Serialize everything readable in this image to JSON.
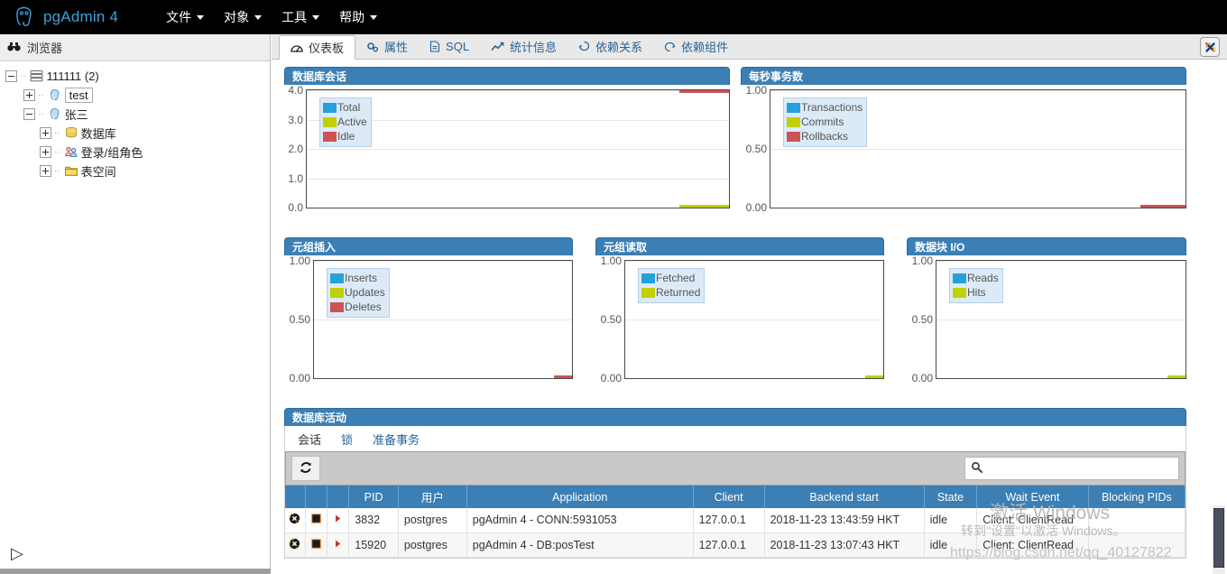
{
  "app": {
    "brand": "pgAdmin 4",
    "logo_icon": "pgadmin-elephant-logo"
  },
  "menubar": {
    "items": [
      {
        "label": "文件",
        "icon": "chevron-down-icon"
      },
      {
        "label": "对象",
        "icon": "chevron-down-icon"
      },
      {
        "label": "工具",
        "icon": "chevron-down-icon"
      },
      {
        "label": "帮助",
        "icon": "chevron-down-icon"
      }
    ]
  },
  "sidebar": {
    "header": "浏览器",
    "header_icon": "binoculars-icon",
    "expand_toggle": "▷",
    "tree": [
      {
        "label": "111111 (2)",
        "icon": "server-group-icon",
        "toggle": "minus",
        "depth": 0,
        "selected": false
      },
      {
        "label": "test",
        "icon": "server-icon",
        "toggle": "plus",
        "depth": 1,
        "selected": true
      },
      {
        "label": "张三",
        "icon": "server-icon",
        "toggle": "minus",
        "depth": 1,
        "selected": false
      },
      {
        "label": "数据库",
        "icon": "database-icon",
        "toggle": "plus",
        "depth": 2,
        "selected": false
      },
      {
        "label": "登录/组角色",
        "icon": "roles-icon",
        "toggle": "plus",
        "depth": 2,
        "selected": false
      },
      {
        "label": "表空间",
        "icon": "tablespace-icon",
        "toggle": "plus",
        "depth": 2,
        "selected": false
      }
    ]
  },
  "tabs": {
    "items": [
      {
        "label": "仪表板",
        "icon": "dashboard-icon",
        "active": true
      },
      {
        "label": "属性",
        "icon": "properties-gears-icon",
        "active": false
      },
      {
        "label": "SQL",
        "icon": "sql-file-icon",
        "active": false
      },
      {
        "label": "统计信息",
        "icon": "statistics-chart-icon",
        "active": false
      },
      {
        "label": "依赖关系",
        "icon": "dependencies-icon",
        "active": false
      },
      {
        "label": "依赖组件",
        "icon": "dependents-icon",
        "active": false
      }
    ],
    "close_label": "✖"
  },
  "colors": {
    "panel_header": "#3b7fb5",
    "series_blue": "#26a0da",
    "series_green": "#c0d000",
    "series_red": "#cc5254",
    "brand_blue": "#3ea0dc",
    "header_bg": "#000000"
  },
  "chart_data": [
    {
      "type": "line",
      "title": "数据库会话",
      "xlabel": "",
      "ylabel": "",
      "ylim": [
        0,
        4
      ],
      "yticks": [
        "0.0",
        "1.0",
        "2.0",
        "3.0",
        "4.0"
      ],
      "grid": true,
      "legend_position": "top-left",
      "series": [
        {
          "name": "Total",
          "color": "#26a0da",
          "values": [
            4
          ]
        },
        {
          "name": "Active",
          "color": "#c0d000",
          "values": [
            0
          ]
        },
        {
          "name": "Idle",
          "color": "#cc5254",
          "values": [
            4
          ]
        }
      ]
    },
    {
      "type": "line",
      "title": "每秒事务数",
      "xlabel": "",
      "ylabel": "",
      "ylim": [
        0,
        1
      ],
      "yticks": [
        "0.00",
        "0.50",
        "1.00"
      ],
      "grid": true,
      "legend_position": "top-left",
      "series": [
        {
          "name": "Transactions",
          "color": "#26a0da",
          "values": [
            0
          ]
        },
        {
          "name": "Commits",
          "color": "#c0d000",
          "values": [
            0
          ]
        },
        {
          "name": "Rollbacks",
          "color": "#cc5254",
          "values": [
            0
          ]
        }
      ]
    },
    {
      "type": "line",
      "title": "元组插入",
      "xlabel": "",
      "ylabel": "",
      "ylim": [
        0,
        1
      ],
      "yticks": [
        "0.00",
        "0.50",
        "1.00"
      ],
      "grid": true,
      "legend_position": "top-left",
      "series": [
        {
          "name": "Inserts",
          "color": "#26a0da",
          "values": [
            0
          ]
        },
        {
          "name": "Updates",
          "color": "#c0d000",
          "values": [
            0
          ]
        },
        {
          "name": "Deletes",
          "color": "#cc5254",
          "values": [
            0
          ]
        }
      ]
    },
    {
      "type": "line",
      "title": "元组读取",
      "xlabel": "",
      "ylabel": "",
      "ylim": [
        0,
        1
      ],
      "yticks": [
        "0.00",
        "0.50",
        "1.00"
      ],
      "grid": true,
      "legend_position": "top-left",
      "series": [
        {
          "name": "Fetched",
          "color": "#26a0da",
          "values": [
            0
          ]
        },
        {
          "name": "Returned",
          "color": "#c0d000",
          "values": [
            0
          ]
        }
      ]
    },
    {
      "type": "line",
      "title": "数据块 I/O",
      "xlabel": "",
      "ylabel": "",
      "ylim": [
        0,
        1
      ],
      "yticks": [
        "0.00",
        "0.50",
        "1.00"
      ],
      "grid": true,
      "legend_position": "top-left",
      "series": [
        {
          "name": "Reads",
          "color": "#26a0da",
          "values": [
            0
          ]
        },
        {
          "name": "Hits",
          "color": "#c0d000",
          "values": [
            0
          ]
        }
      ]
    }
  ],
  "activity": {
    "title": "数据库活动",
    "tabs": [
      {
        "label": "会话",
        "active": true
      },
      {
        "label": "锁",
        "active": false
      },
      {
        "label": "准备事务",
        "active": false
      }
    ],
    "refresh_icon": "refresh-icon",
    "search": {
      "placeholder": "",
      "value": "",
      "icon": "search-icon"
    },
    "columns": [
      "",
      "",
      "",
      "PID",
      "用户",
      "Application",
      "Client",
      "Backend start",
      "State",
      "Wait Event",
      "Blocking PIDs"
    ],
    "rows": [
      {
        "terminate_icon": "terminate-session-icon",
        "cancel_icon": "cancel-query-icon",
        "details_icon": "expand-details-icon",
        "pid": "3832",
        "user": "postgres",
        "application": "pgAdmin 4 - CONN:5931053",
        "client": "127.0.0.1",
        "backend_start": "2018-11-23 13:43:59 HKT",
        "state": "idle",
        "wait_event": "Client: ClientRead",
        "blocking_pids": ""
      },
      {
        "terminate_icon": "terminate-session-icon",
        "cancel_icon": "cancel-query-icon",
        "details_icon": "expand-details-icon",
        "pid": "15920",
        "user": "postgres",
        "application": "pgAdmin 4 - DB:posTest",
        "client": "127.0.0.1",
        "backend_start": "2018-11-23 13:07:43 HKT",
        "state": "idle",
        "wait_event": "Client: ClientRead",
        "blocking_pids": ""
      }
    ]
  },
  "watermark": {
    "line1": "激活 Windows",
    "line2": "转到\"设置\"以激活 Windows。",
    "line3": "https://blog.csdn.net/qq_40127822"
  }
}
